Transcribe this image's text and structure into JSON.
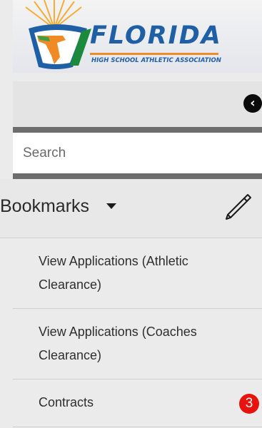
{
  "header": {
    "wordmark": "FLORIDA",
    "tagline": "HIGH SCHOOL ATHLETIC ASSOCIATION"
  },
  "collapse": {
    "icon": "chevron-left-icon",
    "glyph": "‹"
  },
  "search": {
    "placeholder": "Search"
  },
  "bookmarks": {
    "label": "Bookmarks",
    "edit_icon": "pencil-icon"
  },
  "menu": {
    "items": [
      {
        "label": "View Applications (Athletic Clearance)"
      },
      {
        "label": "View Applications (Coaches Clearance)"
      },
      {
        "label": "Contracts",
        "badge": "3"
      }
    ]
  },
  "colors": {
    "brand_blue": "#1f5fa6",
    "brand_orange": "#f08a24",
    "badge_red": "#e8130f",
    "divider": "#6d6d6d"
  }
}
